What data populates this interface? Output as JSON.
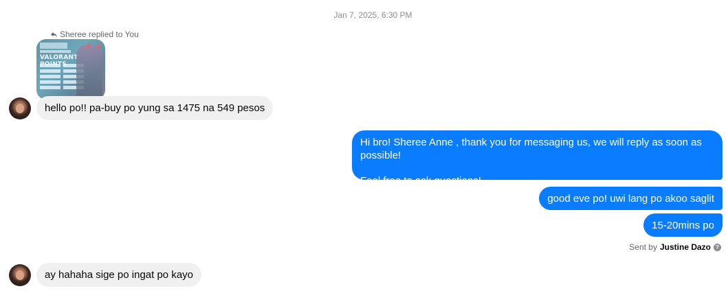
{
  "conversation": {
    "timestamp": "Jan 7, 2025, 6:30 PM",
    "reply_note": "Sheree replied to You",
    "reply_thumbnail": {
      "title": "VALORANT POINTS",
      "icon": "valorant-points-image"
    },
    "messages": [
      {
        "direction": "incoming",
        "text": "hello po!! pa-buy po yung sa 1475 na 549 pesos"
      },
      {
        "direction": "outgoing",
        "lines": [
          "Hi bro! Sheree Anne , thank you for messaging us, we will reply as soon as possible!",
          "Feel free to ask questions!"
        ]
      },
      {
        "direction": "outgoing",
        "text": "good eve po! uwi lang po akoo saglit"
      },
      {
        "direction": "outgoing",
        "text": "15-20mins po"
      },
      {
        "direction": "incoming",
        "text": "ay hahaha sige po ingat po kayo"
      }
    ],
    "sent_by": {
      "prefix": "Sent by",
      "name": "Justine Dazo",
      "icon": "info-icon"
    }
  },
  "colors": {
    "outgoing_bubble": "#0a7cff",
    "incoming_bubble": "#f0f0f0",
    "meta_text": "#65676b"
  }
}
